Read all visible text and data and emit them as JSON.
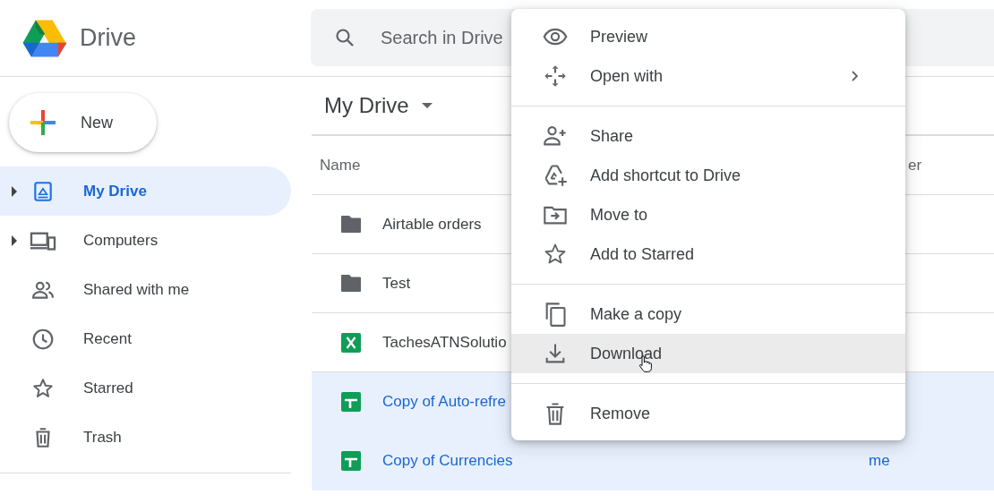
{
  "app": {
    "name": "Drive"
  },
  "search": {
    "placeholder": "Search in Drive"
  },
  "new_button": {
    "label": "New"
  },
  "sidebar": {
    "items": [
      {
        "label": "My Drive",
        "kind": "drive",
        "selected": true,
        "expandable": true
      },
      {
        "label": "Computers",
        "kind": "computers",
        "selected": false,
        "expandable": true
      },
      {
        "label": "Shared with me",
        "kind": "shared",
        "selected": false,
        "expandable": false
      },
      {
        "label": "Recent",
        "kind": "recent",
        "selected": false,
        "expandable": false
      },
      {
        "label": "Starred",
        "kind": "starred",
        "selected": false,
        "expandable": false
      },
      {
        "label": "Trash",
        "kind": "trash",
        "selected": false,
        "expandable": false
      }
    ]
  },
  "main": {
    "title": "My Drive",
    "table": {
      "columns": [
        "Name",
        "er"
      ],
      "rows": [
        {
          "name": "Airtable orders",
          "kind": "folder",
          "selected": false
        },
        {
          "name": "Test",
          "kind": "folder",
          "selected": false
        },
        {
          "name": "TachesATNSolutio",
          "kind": "excel",
          "selected": false
        },
        {
          "name": "Copy of Auto-refre",
          "kind": "sheets",
          "selected": true
        },
        {
          "name": "Copy of Currencies",
          "kind": "sheets",
          "selected": true,
          "column_2": "me"
        }
      ]
    }
  },
  "context_menu": {
    "groups": [
      [
        {
          "label": "Preview",
          "kind": "preview",
          "hovered": false
        },
        {
          "label": "Open with",
          "kind": "open",
          "hovered": false,
          "submenu": true
        }
      ],
      [
        {
          "label": "Share",
          "kind": "share",
          "hovered": false
        },
        {
          "label": "Add shortcut to Drive",
          "kind": "shortcut",
          "hovered": false
        },
        {
          "label": "Move to",
          "kind": "move",
          "hovered": false
        },
        {
          "label": "Add to Starred",
          "kind": "star",
          "hovered": false
        }
      ],
      [
        {
          "label": "Make a copy",
          "kind": "copy",
          "hovered": false
        },
        {
          "label": "Download",
          "kind": "download",
          "hovered": true
        }
      ],
      [
        {
          "label": "Remove",
          "kind": "remove",
          "hovered": false
        }
      ]
    ]
  }
}
